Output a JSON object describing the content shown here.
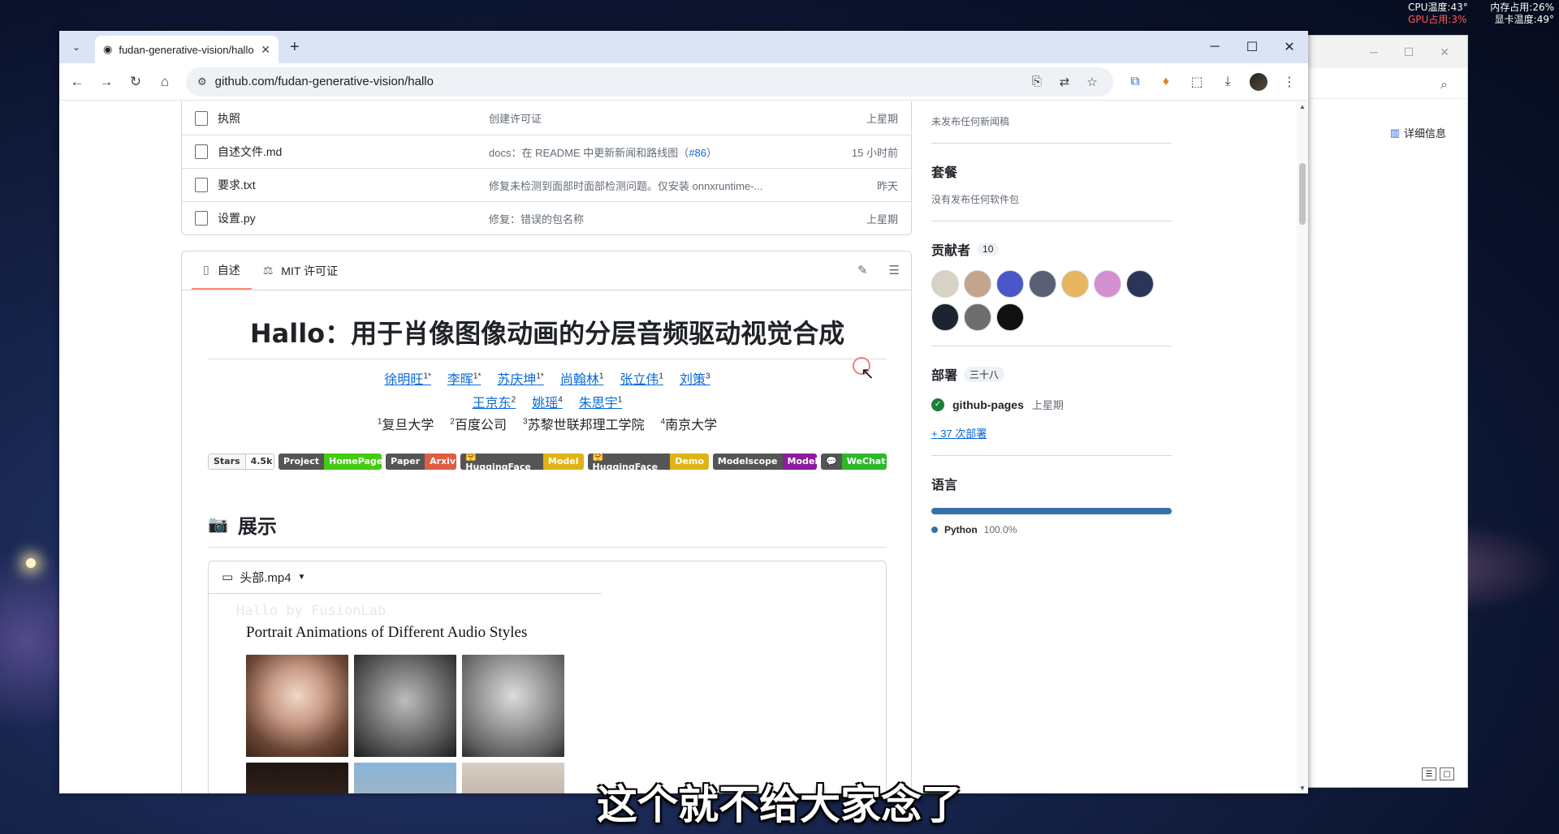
{
  "system_monitor": {
    "cpu_temp": "CPU温度:43°",
    "mem_usage": "内存占用:26%",
    "gpu_usage": "GPU占用:3%",
    "gpu_temp": "显卡温度:49°"
  },
  "background_window": {
    "detail_label": "详细信息"
  },
  "browser": {
    "tab_title": "fudan-generative-vision/hallo",
    "url": "github.com/fudan-generative-vision/hallo"
  },
  "files": [
    {
      "name": "执照",
      "message": "创建许可证",
      "link": "",
      "suffix": "",
      "time": "上星期"
    },
    {
      "name": "自述文件.md",
      "message": "docs：在 README 中更新新闻和路线图（",
      "link": "#86",
      "suffix": "）",
      "time": "15 小时前"
    },
    {
      "name": "要求.txt",
      "message": "修复未检测到面部时面部检测问题。仅安装 onnxruntime-...",
      "link": "",
      "suffix": "",
      "time": "昨天"
    },
    {
      "name": "设置.py",
      "message": "修复：错误的包名称",
      "link": "",
      "suffix": "",
      "time": "上星期"
    }
  ],
  "readme": {
    "tab_readme": "自述",
    "tab_license": "MIT 许可证",
    "title": "Hallo：用于肖像图像动画的分层音频驱动视觉合成",
    "authors_line1": [
      {
        "name": "徐明旺",
        "sup": "1*"
      },
      {
        "name": "李晖",
        "sup": "1*"
      },
      {
        "name": "苏庆坤",
        "sup": "1*"
      },
      {
        "name": "尚翰林",
        "sup": "1"
      },
      {
        "name": "张立伟",
        "sup": "1"
      },
      {
        "name": "刘策",
        "sup": "3"
      }
    ],
    "authors_line2": [
      {
        "name": "王京东",
        "sup": "2"
      },
      {
        "name": "姚瑶",
        "sup": "4"
      },
      {
        "name": "朱思宇",
        "sup": "1"
      }
    ],
    "affiliations": [
      {
        "sup": "1",
        "name": "复旦大学"
      },
      {
        "sup": "2",
        "name": "百度公司"
      },
      {
        "sup": "3",
        "name": "苏黎世联邦理工学院"
      },
      {
        "sup": "4",
        "name": "南京大学"
      }
    ],
    "badges": [
      {
        "left": "Stars",
        "right": "4.5k",
        "color": "#ffffff",
        "type": "gh"
      },
      {
        "left": "Project",
        "right": "HomePage",
        "color": "#4c1"
      },
      {
        "left": "Paper",
        "right": "Arxiv",
        "color": "#e05d44"
      },
      {
        "left": "🤗 HuggingFace",
        "right": "Model",
        "color": "#dfb317"
      },
      {
        "left": "🤗 HuggingFace",
        "right": "Demo",
        "color": "#dfb317"
      },
      {
        "left": "Modelscope",
        "right": "Model",
        "color": "#8a1c9e"
      },
      {
        "left": "💬",
        "right": "WeChat",
        "color": "#2cb829"
      }
    ],
    "section_title": "展示",
    "video_name": "头部.mp4",
    "video_watermark": "Hallo by FusionLab",
    "video_caption": "Portrait Animations of Different Audio Styles"
  },
  "sidebar": {
    "news_empty": "未发布任何新闻稿",
    "packages_title": "套餐",
    "packages_empty": "没有发布任何软件包",
    "contributors_title": "贡献者",
    "contributors_count": "10",
    "avatar_colors": [
      "#d8d2c4",
      "#c4a48c",
      "#4b57c8",
      "#596075",
      "#e8b560",
      "#d48fd0",
      "#2a3558",
      "#1d2430",
      "#6e6e6e",
      "#111111"
    ],
    "deployments_title": "部署",
    "deployments_count": "三十八",
    "deployment_name": "github-pages",
    "deployment_time": "上星期",
    "more_deployments": "+ 37 次部署",
    "languages_title": "语言",
    "language_name": "Python",
    "language_pct": "100.0%",
    "language_color": "#3572A5"
  },
  "subtitle": "这个就不给大家念了"
}
